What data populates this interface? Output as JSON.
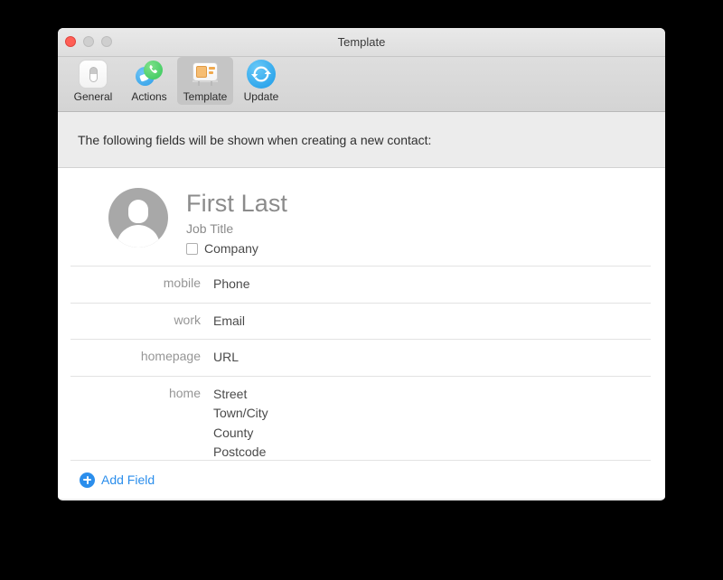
{
  "window": {
    "title": "Template",
    "traffic_lights": [
      "close",
      "minimize",
      "zoom"
    ]
  },
  "toolbar": {
    "items": [
      {
        "label": "General",
        "icon": "toggle-switch-icon",
        "selected": false
      },
      {
        "label": "Actions",
        "icon": "phone-message-icon",
        "selected": false
      },
      {
        "label": "Template",
        "icon": "template-card-icon",
        "selected": true
      },
      {
        "label": "Update",
        "icon": "refresh-sync-icon",
        "selected": false
      }
    ]
  },
  "instruction": {
    "text": "The following fields will be shown when creating a new contact:"
  },
  "contact_card": {
    "avatar": "person-placeholder-avatar",
    "name": "First Last",
    "job_title": "Job Title",
    "company": {
      "label": "Company",
      "checked": false
    },
    "fields": [
      {
        "label": "mobile",
        "values": [
          "Phone"
        ]
      },
      {
        "label": "work",
        "values": [
          "Email"
        ]
      },
      {
        "label": "homepage",
        "values": [
          "URL"
        ]
      },
      {
        "label": "home",
        "values": [
          "Street",
          "Town/City",
          "County",
          "Postcode"
        ]
      }
    ]
  },
  "footer": {
    "add_field_label": "Add Field",
    "add_field_icon": "plus-circle-icon"
  },
  "colors": {
    "accent_blue": "#2b8eec",
    "close_red": "#ff5f56",
    "inactive_gray": "#cfcfcf",
    "label_gray": "#969696",
    "value_gray": "#4a4a4a",
    "avatar_gray": "#a8a8a8",
    "toolbar_selected": "#c5c5c5"
  }
}
